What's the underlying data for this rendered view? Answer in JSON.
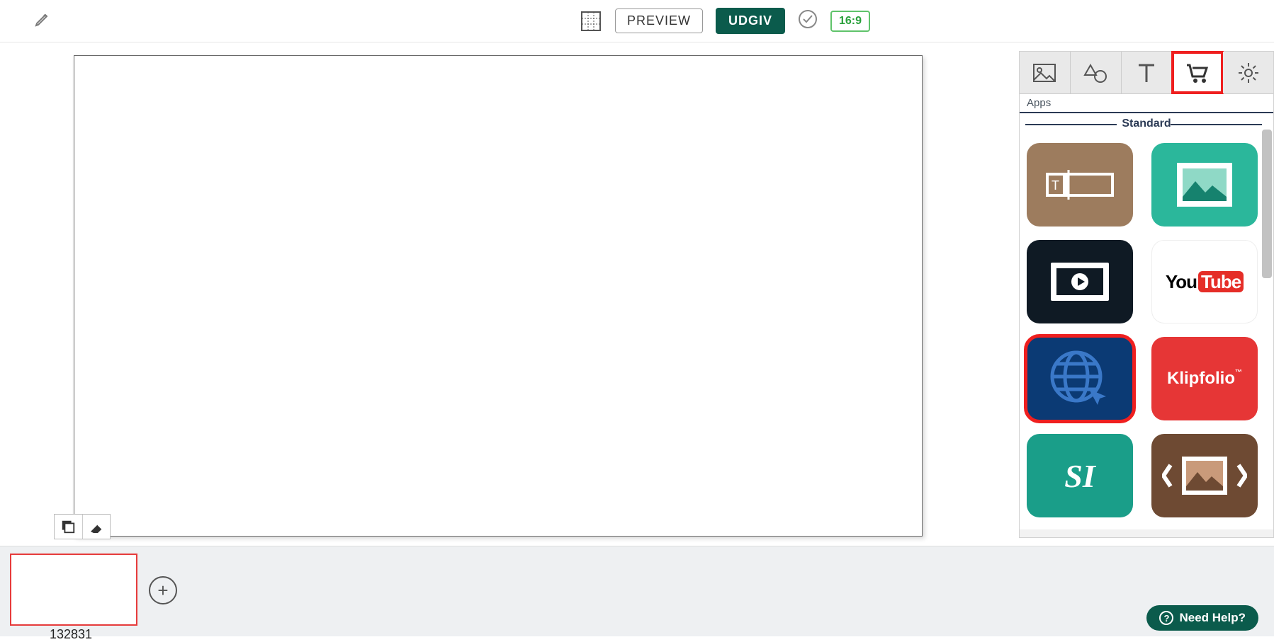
{
  "topbar": {
    "preview_label": "PREVIEW",
    "publish_label": "UDGIV",
    "ratio_label": "16:9"
  },
  "canvas_tools": {
    "layers_label": "",
    "erase_label": ""
  },
  "filmstrip": {
    "slide_id": "132831"
  },
  "panel": {
    "subhead": "Apps",
    "section": "Standard",
    "apps": [
      {
        "key": "textbox",
        "name": "Text box"
      },
      {
        "key": "image",
        "name": "Image"
      },
      {
        "key": "video",
        "name": "Video"
      },
      {
        "key": "youtube",
        "name": "YouTube",
        "logo_you": "You",
        "logo_tube": "Tube"
      },
      {
        "key": "web",
        "name": "Web / URL"
      },
      {
        "key": "klipfolio",
        "name": "Klipfolio",
        "logo_text": "Klipfolio"
      },
      {
        "key": "si",
        "name": "SI",
        "logo_text": "SI"
      },
      {
        "key": "carousel",
        "name": "Image carousel"
      }
    ]
  },
  "help": {
    "label": "Need Help?"
  }
}
